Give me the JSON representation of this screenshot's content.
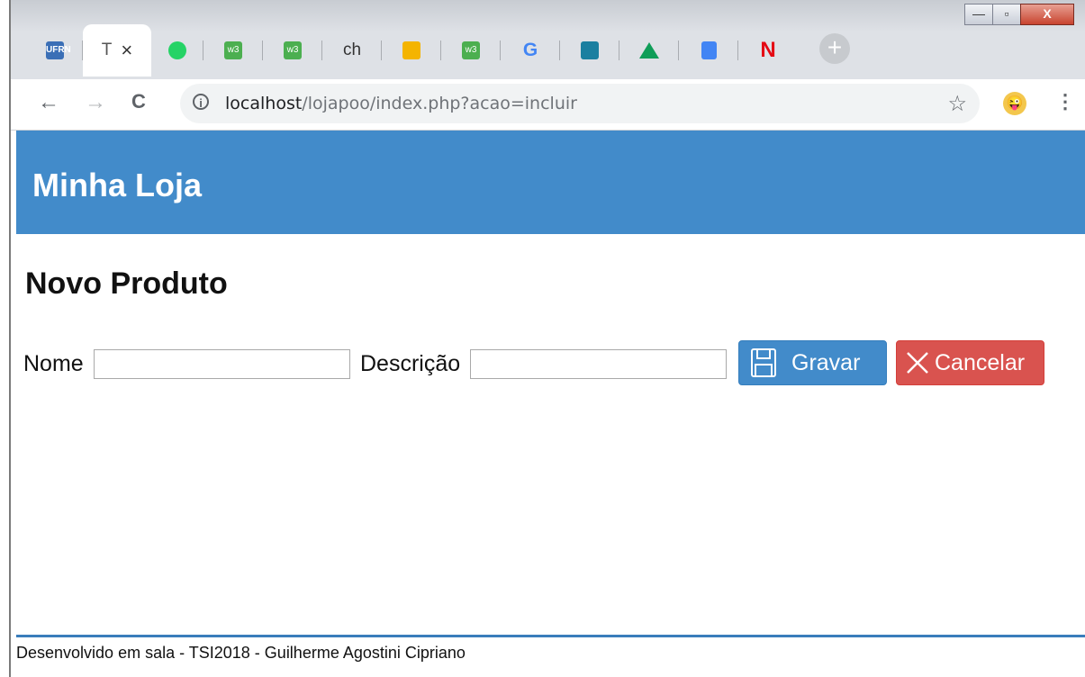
{
  "browser": {
    "tabs": [
      {
        "label": "",
        "icon": "ufrn-favicon",
        "color": "#3b6fb6",
        "active": false
      },
      {
        "label": "T",
        "icon": "page-favicon",
        "active": true,
        "close": "×"
      },
      {
        "label": "",
        "icon": "whatsapp-icon",
        "color": "#25d366"
      },
      {
        "label": "",
        "icon": "w3schools-icon",
        "color": "#4caf50"
      },
      {
        "label": "",
        "icon": "w3schools-icon",
        "color": "#4caf50"
      },
      {
        "label": "ch",
        "icon": "text-favicon"
      },
      {
        "label": "",
        "icon": "chat-icon",
        "color": "#f4b400"
      },
      {
        "label": "",
        "icon": "w3schools-icon",
        "color": "#4caf50"
      },
      {
        "label": "",
        "icon": "google-icon",
        "color": "#4285f4"
      },
      {
        "label": "",
        "icon": "bird-icon",
        "color": "#1a1a1a"
      },
      {
        "label": "",
        "icon": "drive-icon",
        "color": "#0f9d58"
      },
      {
        "label": "",
        "icon": "docs-icon",
        "color": "#4285f4"
      },
      {
        "label": "",
        "icon": "netflix-icon",
        "color": "#e50914"
      }
    ],
    "new_tab_glyph": "+",
    "window_controls": {
      "minimize": "—",
      "maximize": "▫",
      "close": "X"
    },
    "nav": {
      "back": "←",
      "forward": "→",
      "reload": "C"
    },
    "url": {
      "host": "localhost",
      "path": "/lojapoo/index.php?acao=incluir"
    },
    "info_glyph": "i",
    "star_glyph": "☆",
    "menu_glyph": "⋮"
  },
  "header": {
    "brand": "Minha Loja",
    "color": "#428bca"
  },
  "main": {
    "title": "Novo Produto",
    "form": {
      "nome_label": "Nome",
      "nome_value": "",
      "descricao_label": "Descrição",
      "descricao_value": "",
      "save_label": "Gravar",
      "cancel_label": "Cancelar"
    }
  },
  "footer": {
    "text": "Desenvolvido em sala - TSI2018 - Guilherme Agostini Cipriano"
  }
}
